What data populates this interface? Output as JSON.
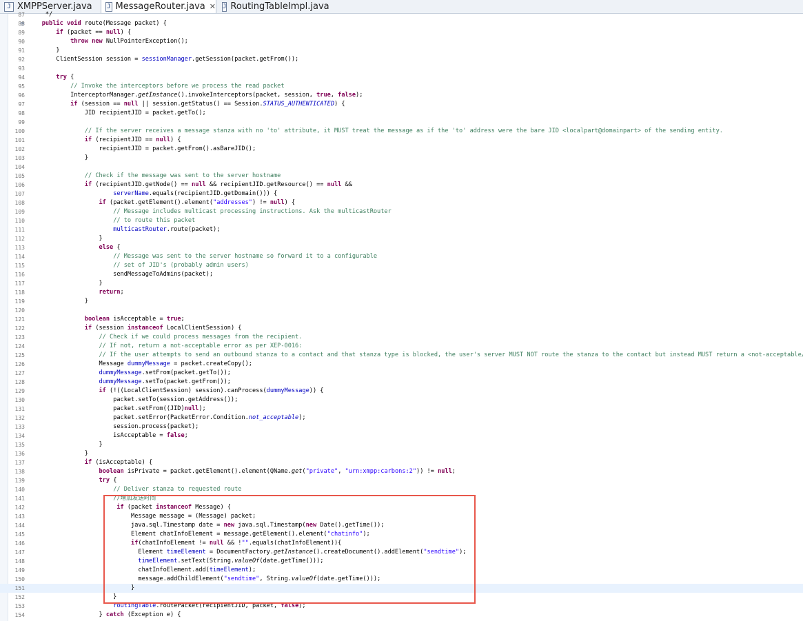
{
  "tabs": [
    {
      "label": "XMPPServer.java",
      "icon": "java-file-icon"
    },
    {
      "label": "MessageRouter.java",
      "icon": "java-file-icon",
      "active": true,
      "close": "✕"
    },
    {
      "label": "RoutingTableImpl.java",
      "icon": "java-file-icon"
    }
  ],
  "lines": [
    {
      "num": "87",
      "code": "     */"
    },
    {
      "num": "88",
      "fold": "⊖",
      "code": "    public void route(Message packet) {"
    },
    {
      "num": "89",
      "code": "        if (packet == null) {"
    },
    {
      "num": "90",
      "code": "            throw new NullPointerException();"
    },
    {
      "num": "91",
      "code": "        }"
    },
    {
      "num": "92",
      "code": "        ClientSession session = sessionManager.getSession(packet.getFrom());"
    },
    {
      "num": "93",
      "code": ""
    },
    {
      "num": "94",
      "code": "        try {"
    },
    {
      "num": "95",
      "code": "            // Invoke the interceptors before we process the read packet"
    },
    {
      "num": "96",
      "code": "            InterceptorManager.getInstance().invokeInterceptors(packet, session, true, false);"
    },
    {
      "num": "97",
      "code": "            if (session == null || session.getStatus() == Session.STATUS_AUTHENTICATED) {"
    },
    {
      "num": "98",
      "code": "                JID recipientJID = packet.getTo();"
    },
    {
      "num": "99",
      "code": ""
    },
    {
      "num": "100",
      "code": "                // If the server receives a message stanza with no 'to' attribute, it MUST treat the message as if the 'to' address were the bare JID <localpart@domainpart> of the sending entity."
    },
    {
      "num": "101",
      "code": "                if (recipientJID == null) {"
    },
    {
      "num": "102",
      "code": "                    recipientJID = packet.getFrom().asBareJID();"
    },
    {
      "num": "103",
      "code": "                }"
    },
    {
      "num": "104",
      "code": ""
    },
    {
      "num": "105",
      "code": "                // Check if the message was sent to the server hostname"
    },
    {
      "num": "106",
      "code": "                if (recipientJID.getNode() == null && recipientJID.getResource() == null &&"
    },
    {
      "num": "107",
      "code": "                        serverName.equals(recipientJID.getDomain())) {"
    },
    {
      "num": "108",
      "code": "                    if (packet.getElement().element(\"addresses\") != null) {"
    },
    {
      "num": "109",
      "code": "                        // Message includes multicast processing instructions. Ask the multicastRouter"
    },
    {
      "num": "110",
      "code": "                        // to route this packet"
    },
    {
      "num": "111",
      "code": "                        multicastRouter.route(packet);"
    },
    {
      "num": "112",
      "code": "                    }"
    },
    {
      "num": "113",
      "code": "                    else {"
    },
    {
      "num": "114",
      "code": "                        // Message was sent to the server hostname so forward it to a configurable"
    },
    {
      "num": "115",
      "code": "                        // set of JID's (probably admin users)"
    },
    {
      "num": "116",
      "code": "                        sendMessageToAdmins(packet);"
    },
    {
      "num": "117",
      "code": "                    }"
    },
    {
      "num": "118",
      "code": "                    return;"
    },
    {
      "num": "119",
      "code": "                }"
    },
    {
      "num": "120",
      "code": ""
    },
    {
      "num": "121",
      "code": "                boolean isAcceptable = true;"
    },
    {
      "num": "122",
      "code": "                if (session instanceof LocalClientSession) {"
    },
    {
      "num": "123",
      "code": "                    // Check if we could process messages from the recipient."
    },
    {
      "num": "124",
      "code": "                    // If not, return a not-acceptable error as per XEP-0016:"
    },
    {
      "num": "125",
      "code": "                    // If the user attempts to send an outbound stanza to a contact and that stanza type is blocked, the user's server MUST NOT route the stanza to the contact but instead MUST return a <not-acceptable/> error"
    },
    {
      "num": "126",
      "code": "                    Message dummyMessage = packet.createCopy();"
    },
    {
      "num": "127",
      "code": "                    dummyMessage.setFrom(packet.getTo());"
    },
    {
      "num": "128",
      "code": "                    dummyMessage.setTo(packet.getFrom());"
    },
    {
      "num": "129",
      "code": "                    if (!((LocalClientSession) session).canProcess(dummyMessage)) {"
    },
    {
      "num": "130",
      "code": "                        packet.setTo(session.getAddress());"
    },
    {
      "num": "131",
      "code": "                        packet.setFrom((JID)null);"
    },
    {
      "num": "132",
      "code": "                        packet.setError(PacketError.Condition.not_acceptable);"
    },
    {
      "num": "133",
      "code": "                        session.process(packet);"
    },
    {
      "num": "134",
      "code": "                        isAcceptable = false;"
    },
    {
      "num": "135",
      "code": "                    }"
    },
    {
      "num": "136",
      "code": "                }"
    },
    {
      "num": "137",
      "code": "                if (isAcceptable) {"
    },
    {
      "num": "138",
      "code": "                    boolean isPrivate = packet.getElement().element(QName.get(\"private\", \"urn:xmpp:carbons:2\")) != null;"
    },
    {
      "num": "139",
      "code": "                    try {"
    },
    {
      "num": "140",
      "code": "                        // Deliver stanza to requested route"
    },
    {
      "num": "141",
      "code": "                        //增加发送时间"
    },
    {
      "num": "142",
      "code": "                         if (packet instanceof Message) {"
    },
    {
      "num": "143",
      "code": "                             Message message = (Message) packet;"
    },
    {
      "num": "144",
      "code": "                             java.sql.Timestamp date = new java.sql.Timestamp(new Date().getTime());"
    },
    {
      "num": "145",
      "code": "                             Element chatInfoElement = message.getElement().element(\"chatinfo\");"
    },
    {
      "num": "146",
      "code": "                             if(chatInfoElement != null && !\"\".equals(chatInfoElement)){"
    },
    {
      "num": "147",
      "code": "                               Element timeElement = DocumentFactory.getInstance().createDocument().addElement(\"sendtime\");"
    },
    {
      "num": "148",
      "code": "                               timeElement.setText(String.valueOf(date.getTime()));"
    },
    {
      "num": "149",
      "code": "                               chatInfoElement.add(timeElement);"
    },
    {
      "num": "150",
      "code": "                               message.addChildElement(\"sendtime\", String.valueOf(date.getTime()));"
    },
    {
      "num": "151",
      "code": "                             }",
      "current": true
    },
    {
      "num": "152",
      "code": "                        }"
    },
    {
      "num": "153",
      "code": "                        routingTable.routePacket(recipientJID, packet, false);"
    },
    {
      "num": "154",
      "code": "                    } catch (Exception e) {"
    }
  ]
}
